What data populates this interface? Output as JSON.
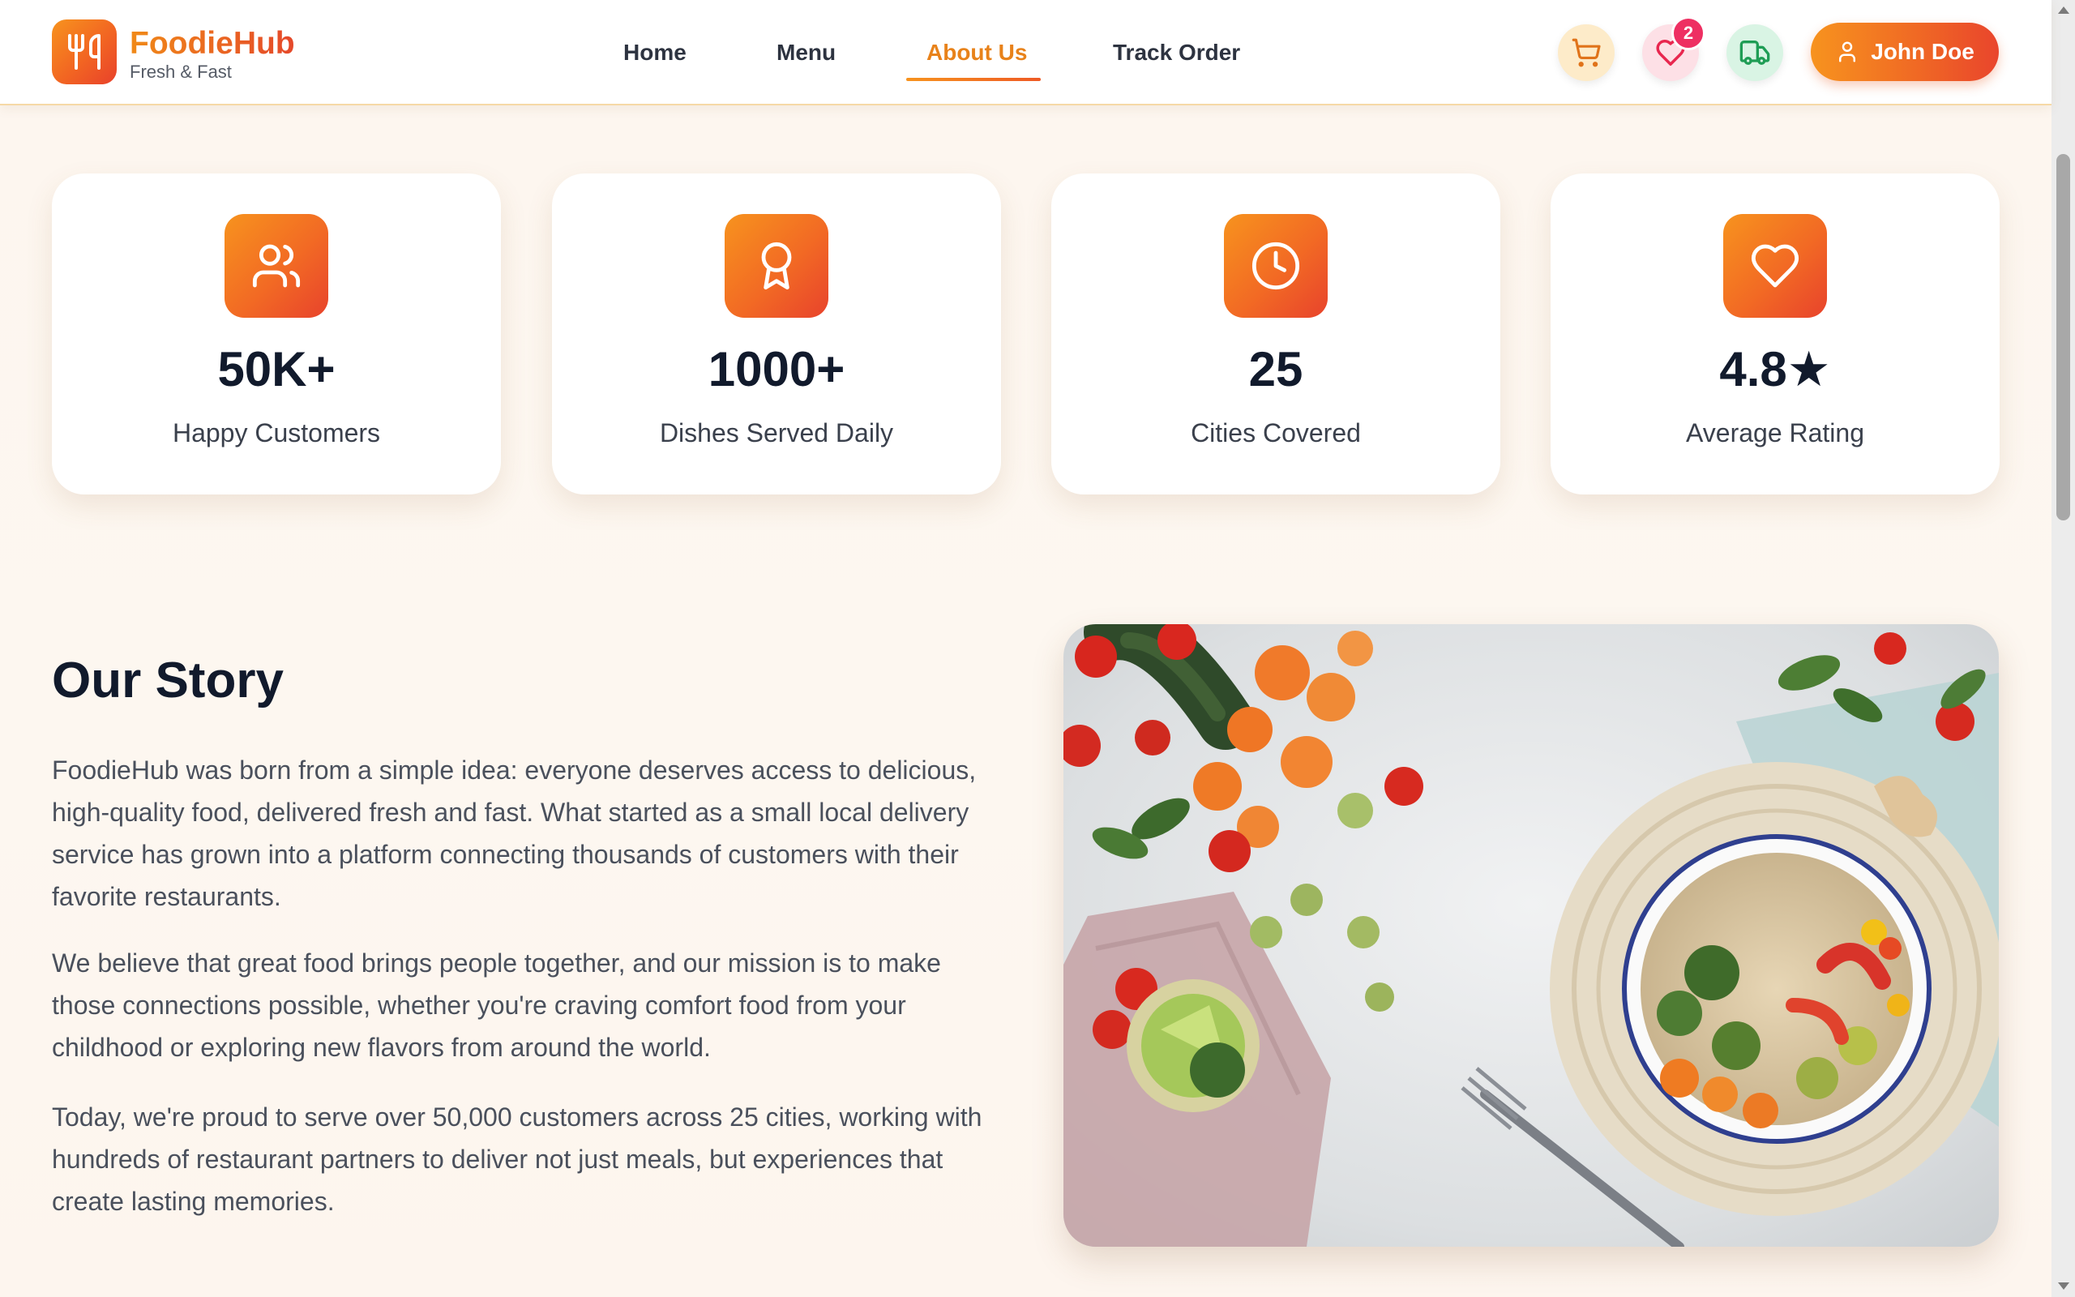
{
  "brand": {
    "name": "FoodieHub",
    "tagline": "Fresh & Fast"
  },
  "nav": {
    "items": [
      {
        "label": "Home",
        "active": false
      },
      {
        "label": "Menu",
        "active": false
      },
      {
        "label": "About Us",
        "active": true
      },
      {
        "label": "Track Order",
        "active": false
      }
    ]
  },
  "header_actions": {
    "cart_icon": "cart-icon",
    "favorites_icon": "heart-icon",
    "favorites_count": "2",
    "track_icon": "truck-icon",
    "user_icon": "user-icon",
    "user_name": "John Doe"
  },
  "stats": [
    {
      "icon": "users-icon",
      "value": "50K+",
      "label": "Happy Customers"
    },
    {
      "icon": "award-icon",
      "value": "1000+",
      "label": "Dishes Served Daily"
    },
    {
      "icon": "clock-icon",
      "value": "25",
      "label": "Cities Covered"
    },
    {
      "icon": "heart-icon",
      "value": "4.8★",
      "label": "Average Rating"
    }
  ],
  "story": {
    "title": "Our Story",
    "paragraphs": [
      "FoodieHub was born from a simple idea: everyone deserves access to delicious, high-quality food, delivered fresh and fast. What started as a small local delivery service has grown into a platform connecting thousands of customers with their favorite restaurants.",
      "We believe that great food brings people together, and our mission is to make those connections possible, whether you're craving comfort food from your childhood or exploring new flavors from around the world.",
      "Today, we're proud to serve over 50,000 customers across 25 cities, working with hundreds of restaurant partners to deliver not just meals, but experiences that create lasting memories."
    ]
  },
  "colors": {
    "accent_orange": "#f7931e",
    "accent_red": "#e8432c",
    "background": "#fdf6ef",
    "heading": "#111a2c",
    "body_text": "#4a505c"
  }
}
